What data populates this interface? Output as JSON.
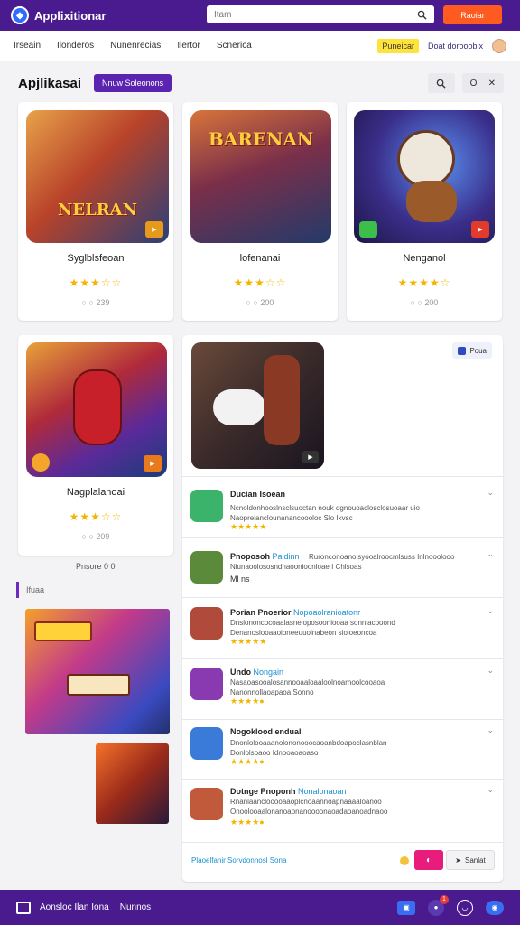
{
  "app": {
    "title": "Applixitionar",
    "search_placeholder": "Itam",
    "cta": "Raoiar"
  },
  "nav": {
    "items": [
      "Irseain",
      "Ilonderos",
      "Nunenrecias",
      "Ilertor",
      "Scnerica"
    ],
    "badge": "Puneicar",
    "link": "Doat dorooobix"
  },
  "page": {
    "title": "Apjlikasai",
    "filter_label": "Nnuw Soleonons",
    "tool_label": "Ol"
  },
  "cards": [
    {
      "name": "Syglblsfeoan",
      "thumb_text": "NELRAN",
      "stars": "★★★☆☆",
      "meta": "○ ○ 239",
      "color_a": "#d9742a",
      "color_b": "#2b3f77",
      "badge_color": "#e59a1c"
    },
    {
      "name": "lofenanai",
      "thumb_text": "BARENAN",
      "stars": "★★★☆☆",
      "meta": "○ ○ 200",
      "color_a": "#a7462f",
      "color_b": "#233a6a",
      "badge_color": "#4a3a8a"
    },
    {
      "name": "Nenganol",
      "thumb_text": "",
      "stars": "★★★★☆",
      "meta": "○ ○ 200",
      "color_a": "#3b6ed8",
      "color_b": "#1f1546",
      "badge_color": "#e23b2b"
    },
    {
      "name": "Nagplalanoai",
      "thumb_text": "",
      "stars": "★★★☆☆",
      "meta": "○ ○ 209",
      "color_a": "#7a2fb0",
      "color_b": "#1a3d7a",
      "badge_color": "#e87a1c"
    }
  ],
  "pager": "Pnsore 0 0",
  "section": "Ifuaa",
  "feature": {
    "tag": "Poua"
  },
  "rows": [
    {
      "title": "Ducian Isoean",
      "highlight": "",
      "desc1": "Ncnoldonhooslnsclsuoctan nouk dgnouoaclosclosuoaar uio",
      "desc2": "Naopreianclounanancoooloc Slo Ikvsc",
      "stars": "★★★★★",
      "color": "#3bb36a"
    },
    {
      "title": "Pnoposoh",
      "highlight": "Paldinn",
      "desc1": "Ruronconoanolsyooalroocmlsuss Inlnooolooo",
      "desc2": "Niunaoolososndhaoonioonloae I Chlsoas",
      "stars": "Ml ns",
      "color": "#5a8a3a"
    },
    {
      "title": "Porian Pnoerior",
      "highlight": "Nopoaolranioatonr",
      "desc1": "Dnslononcocoaalasneloposooniooaa sonnlacooond",
      "desc2": "Denanoslooaaoioneeuuolnabeon sioloeoncoa",
      "stars": "★★★★★",
      "color": "#b04a3a"
    },
    {
      "title": "Undo",
      "highlight": "Nongain",
      "desc1": "Nasaoasooalosannooaaloaaloolnoarnoolcooaoa",
      "desc2": "Nanonnollaoapaoa Sonno",
      "stars": "★★★★●",
      "color": "#8a3ab0"
    },
    {
      "title": "Nogoklood endual",
      "highlight": "",
      "desc1": "Dnonlolooaaanolononooocaoanbdoapoclasnblan",
      "desc2": "Donlolsoaoo Idnooaoaoaso",
      "stars": "★★★★●",
      "color": "#3a7ad8"
    },
    {
      "title": "Dotnge Pnoponh",
      "highlight": "Nonalonaoan",
      "desc1": "Rnanlaanclooooaaoplcnoaannoapnaaaaloanoo",
      "desc2": "Onoolooaalonanoapnanoooonaoadaoanoadnaoo",
      "stars": "★★★★●",
      "color": "#c05a3a"
    }
  ],
  "actions": {
    "link": "Plaoelfanir Sorvdonnosl Sona",
    "send_label": "Sanlat"
  },
  "bottom": {
    "left_a": "Aonsloc Ilan Iona",
    "left_b": "Nunnos",
    "notif_count": "1"
  },
  "colors": {
    "brand": "#4a1b8f",
    "accent": "#ff5a1f",
    "star": "#f2b600"
  }
}
